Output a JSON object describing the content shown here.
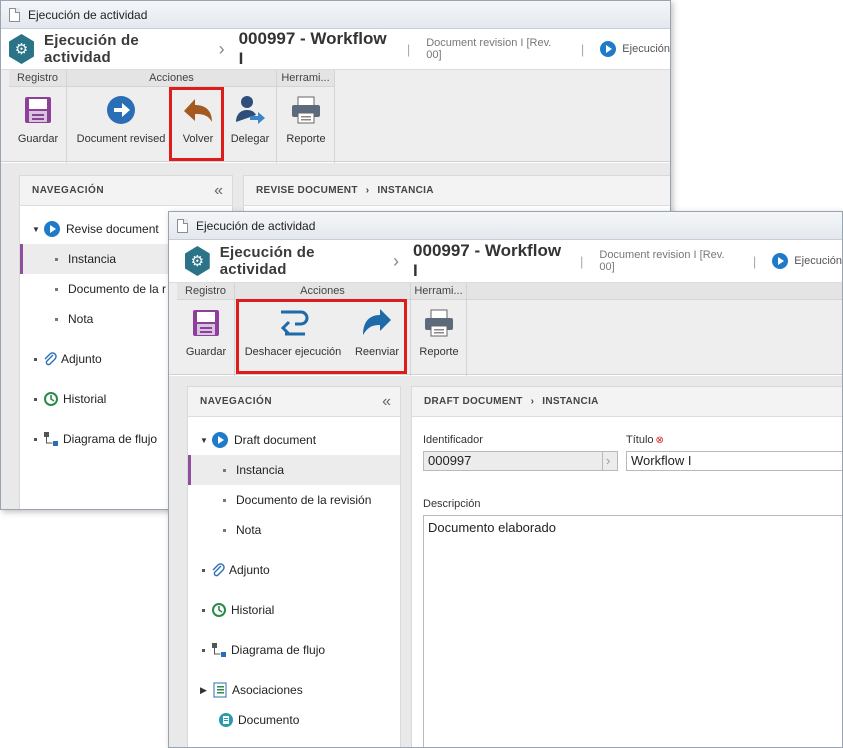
{
  "back_window": {
    "title": "Ejecución de actividad",
    "header": {
      "title": "Ejecución de actividad",
      "separator": "›",
      "record_id": "000997 - Workflow I",
      "pipe": "|",
      "revision": "Document revision I [Rev. 00]",
      "execution": "Ejecución"
    },
    "ribbon": {
      "groups": {
        "registro": "Registro",
        "acciones": "Acciones",
        "herramientas": "Herrami..."
      },
      "buttons": {
        "guardar": "Guardar",
        "document_revised": "Document revised",
        "volver": "Volver",
        "delegar": "Delegar",
        "reporte": "Reporte"
      }
    },
    "nav": {
      "heading": "NAVEGACIÓN",
      "collapse": "«",
      "items": {
        "root": "Revise document",
        "instancia": "Instancia",
        "documento": "Documento de la r",
        "nota": "Nota",
        "adjunto": "Adjunto",
        "historial": "Historial",
        "diagrama": "Diagrama de flujo"
      }
    },
    "breadcrumb": {
      "first": "REVISE DOCUMENT",
      "sep": "›",
      "second": "INSTANCIA"
    }
  },
  "front_window": {
    "title": "Ejecución de actividad",
    "header": {
      "title": "Ejecución de actividad",
      "separator": "›",
      "record_id": "000997 - Workflow I",
      "pipe": "|",
      "revision": "Document revision I [Rev. 00]",
      "execution": "Ejecución"
    },
    "ribbon": {
      "groups": {
        "registro": "Registro",
        "acciones": "Acciones",
        "herramientas": "Herrami..."
      },
      "buttons": {
        "guardar": "Guardar",
        "deshacer": "Deshacer ejecución",
        "reenviar": "Reenviar",
        "reporte": "Reporte"
      }
    },
    "nav": {
      "heading": "NAVEGACIÓN",
      "collapse": "«",
      "items": {
        "root": "Draft document",
        "instancia": "Instancia",
        "documento": "Documento de la revisión",
        "nota": "Nota",
        "adjunto": "Adjunto",
        "historial": "Historial",
        "diagrama": "Diagrama de flujo",
        "asociaciones": "Asociaciones",
        "asoc_documento": "Documento"
      }
    },
    "breadcrumb": {
      "first": "DRAFT DOCUMENT",
      "sep": "›",
      "second": "INSTANCIA"
    },
    "form": {
      "identificador_label": "Identificador",
      "identificador_value": "000997",
      "titulo_label": "Título",
      "titulo_required": "⊗",
      "titulo_value": "Workflow I",
      "descripcion_label": "Descripción",
      "descripcion_value": "Documento elaborado"
    }
  },
  "colors": {
    "highlight_box": "#e01b1b",
    "brand": "#2b7487",
    "accent": "#1f7bc8",
    "selected_bar": "#8e4fa1"
  }
}
